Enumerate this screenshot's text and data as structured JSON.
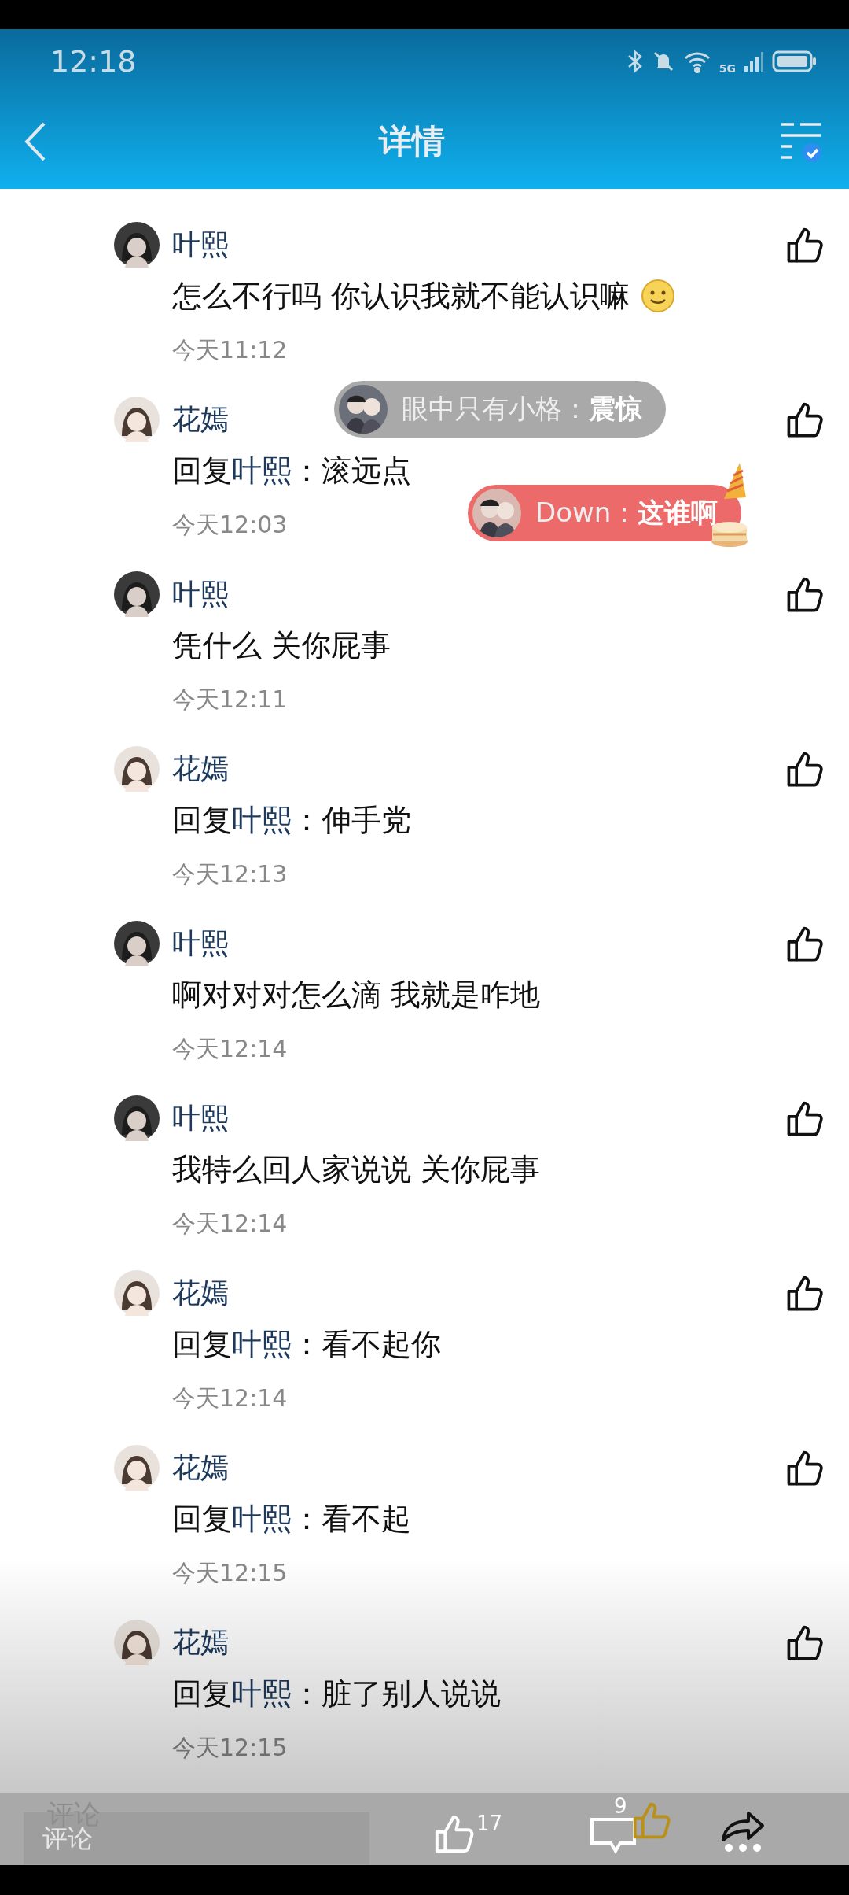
{
  "status_bar": {
    "time": "12:18",
    "network": "5G"
  },
  "header": {
    "title": "详情"
  },
  "comments": [
    {
      "kind": "dark",
      "name": "叶熙",
      "text": "怎么不行吗 你认识我就不能认识嘛",
      "has_emoji": true,
      "time": "今天11:12"
    },
    {
      "kind": "light",
      "name": "花嫣",
      "reply_label": "回复",
      "reply_to": "叶熙",
      "reply_colon": "：",
      "text": "滚远点",
      "time": "今天12:03"
    },
    {
      "kind": "dark",
      "name": "叶熙",
      "text": "凭什么 关你屁事",
      "time": "今天12:11"
    },
    {
      "kind": "light",
      "name": "花嫣",
      "reply_label": "回复",
      "reply_to": "叶熙",
      "reply_colon": "：",
      "text": "伸手党",
      "time": "今天12:13"
    },
    {
      "kind": "dark",
      "name": "叶熙",
      "text": "啊对对对怎么滴 我就是咋地",
      "time": "今天12:14"
    },
    {
      "kind": "dark",
      "name": "叶熙",
      "text": "我特么回人家说说 关你屁事",
      "time": "今天12:14"
    },
    {
      "kind": "light",
      "name": "花嫣",
      "reply_label": "回复",
      "reply_to": "叶熙",
      "reply_colon": "：",
      "text": "看不起你",
      "time": "今天12:14"
    },
    {
      "kind": "light",
      "name": "花嫣",
      "reply_label": "回复",
      "reply_to": "叶熙",
      "reply_colon": "：",
      "text": "看不起",
      "time": "今天12:15"
    },
    {
      "kind": "light",
      "name": "花嫣",
      "reply_label": "回复",
      "reply_to": "叶熙",
      "reply_colon": "：",
      "text": "脏了别人说说",
      "time": "今天12:15"
    }
  ],
  "bullet_comments": [
    {
      "text": "眼中只有小格：**震惊**",
      "color": "#a9a9a9",
      "decorated": false
    },
    {
      "text": "Down：**这谁啊**",
      "color": "#ec6a6a",
      "decorated": true
    }
  ],
  "bottom_bar": {
    "ghost_label": "评论",
    "comment_placeholder": "评论",
    "like_count": "17",
    "comment_count": "9"
  }
}
